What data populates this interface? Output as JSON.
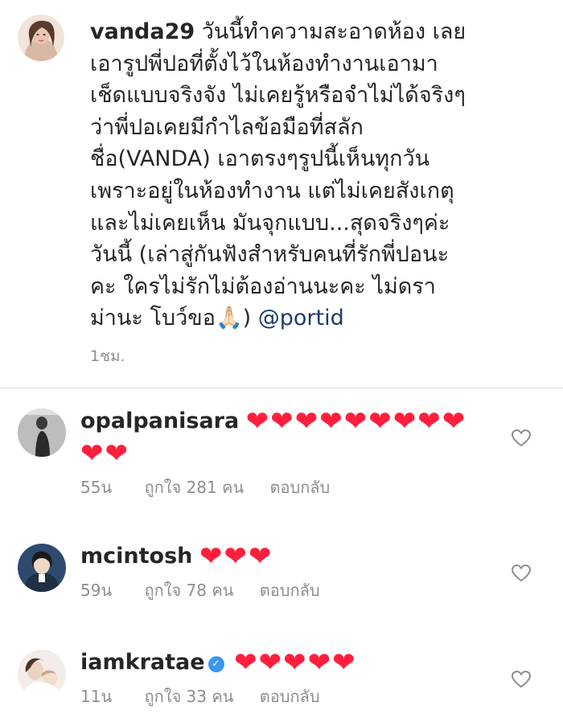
{
  "post": {
    "username": "vanda29",
    "caption": "วันนี้ทำความสะอาดห้อง เลย\nเอารูปพี่ปอที่ตั้งไว้ในห้องทำงานเอามา\nเช็ดแบบจริงจัง ไม่เคยรู้หรือจำไม่ได้จริงๆ\nว่าพี่ปอเคยมีกำไลข้อมือที่สลัก\nชื่อ(VANDA) เอาตรงๆรูปนี้เห็นทุกวัน\nเพราะอยู่ในห้องทำงาน แต่ไม่เคยสังเกตุ\nและไม่เคยเห็น มันจุกแบบ...สุดจริงๆค่ะ\nวันนี้ (เล่าสู่กันฟังสำหรับคนที่รักพี่ปอนะ\nคะ ใครไม่รักไม่ต้องอ่านนะคะ ไม่ดรา\nม่านะ โบว์ขอ🙏🏻)",
    "mention": "@portid",
    "time": "1ชม."
  },
  "comments": [
    {
      "username": "opalpanisara",
      "text": "❤❤❤❤❤❤❤❤❤❤❤",
      "verified": false,
      "time": "55น",
      "likes": "ถูกใจ 281 คน",
      "reply": "ตอบกลับ"
    },
    {
      "username": "mcintosh",
      "text": "❤❤❤",
      "verified": false,
      "time": "59น",
      "likes": "ถูกใจ 78 คน",
      "reply": "ตอบกลับ"
    },
    {
      "username": "iamkratae",
      "text": "❤❤❤❤❤",
      "verified": true,
      "time": "11น",
      "likes": "ถูกใจ 33 คน",
      "reply": "ตอบกลับ"
    }
  ],
  "icons": {
    "like": "heart-outline-icon",
    "verified": "verified-badge-icon"
  },
  "colors": {
    "heart": "#ff1f3d",
    "verified": "#3897f0",
    "meta": "#8e8e8e",
    "mention": "#1e3a6e"
  }
}
